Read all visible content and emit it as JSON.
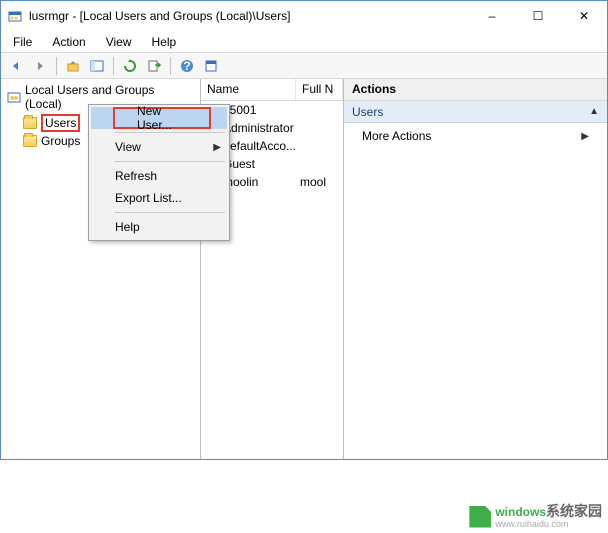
{
  "window": {
    "title": "lusrmgr - [Local Users and Groups (Local)\\Users]",
    "controls": {
      "min": "–",
      "max": "☐",
      "close": "✕"
    }
  },
  "menubar": [
    "File",
    "Action",
    "View",
    "Help"
  ],
  "tree": {
    "root": "Local Users and Groups (Local)",
    "items": [
      "Users",
      "Groups"
    ]
  },
  "list": {
    "columns": [
      "Name",
      "Full N"
    ],
    "rows": [
      {
        "name": "15001",
        "full": ""
      },
      {
        "name": "Administrator",
        "full": ""
      },
      {
        "name": "DefaultAcco...",
        "full": ""
      },
      {
        "name": "Guest",
        "full": ""
      },
      {
        "name": "moolin",
        "full": "mool"
      }
    ]
  },
  "context_menu": {
    "items": [
      "New User...",
      "View",
      "Refresh",
      "Export List...",
      "Help"
    ]
  },
  "actions": {
    "header": "Actions",
    "section": "Users",
    "more": "More Actions"
  },
  "watermark": {
    "brand": "windows",
    "cn": "系统家园",
    "url": "www.ruihaidu.com"
  }
}
